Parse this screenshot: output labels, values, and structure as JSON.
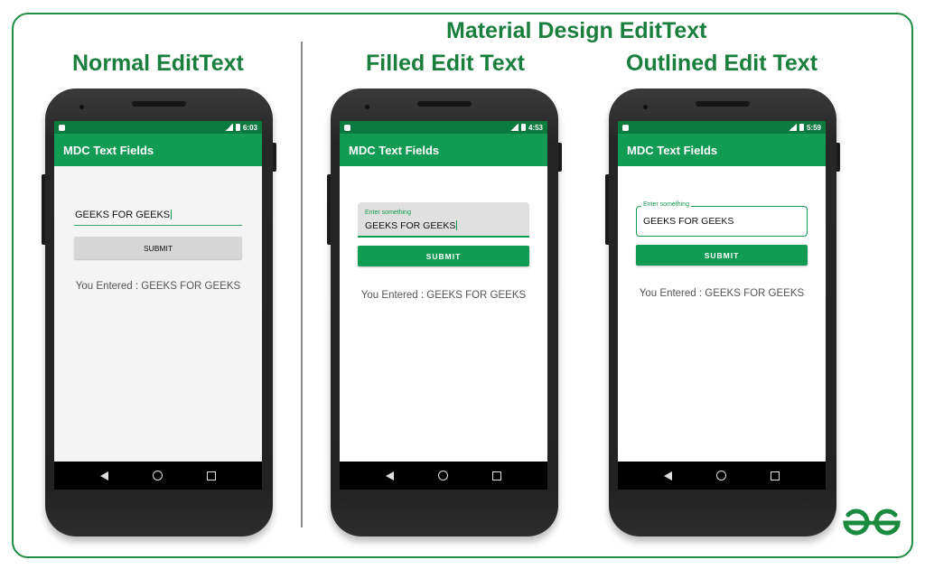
{
  "headings": {
    "material": "Material Design EditText",
    "normal": "Normal EditText",
    "filled": "Filled Edit Text",
    "outlined": "Outlined Edit Text"
  },
  "phones": [
    {
      "time": "6:03",
      "app_title": "MDC Text Fields",
      "input_value": "GEEKS FOR GEEKS",
      "submit_label": "SUBMIT",
      "result": "You Entered : GEEKS FOR GEEKS"
    },
    {
      "time": "4:53",
      "app_title": "MDC Text Fields",
      "field_label": "Enter something",
      "input_value": "GEEKS FOR GEEKS",
      "submit_label": "SUBMIT",
      "result": "You Entered : GEEKS FOR GEEKS"
    },
    {
      "time": "5:59",
      "app_title": "MDC Text Fields",
      "field_label": "Enter something",
      "input_value": "GEEKS FOR GEEKS",
      "submit_label": "SUBMIT",
      "result": "You Entered : GEEKS FOR GEEKS"
    }
  ],
  "colors": {
    "accent": "#129b52",
    "heading": "#1a7f3c",
    "status_bar": "#0b7a3e"
  },
  "logo": {
    "name": "gfg-logo",
    "text": "GG"
  }
}
